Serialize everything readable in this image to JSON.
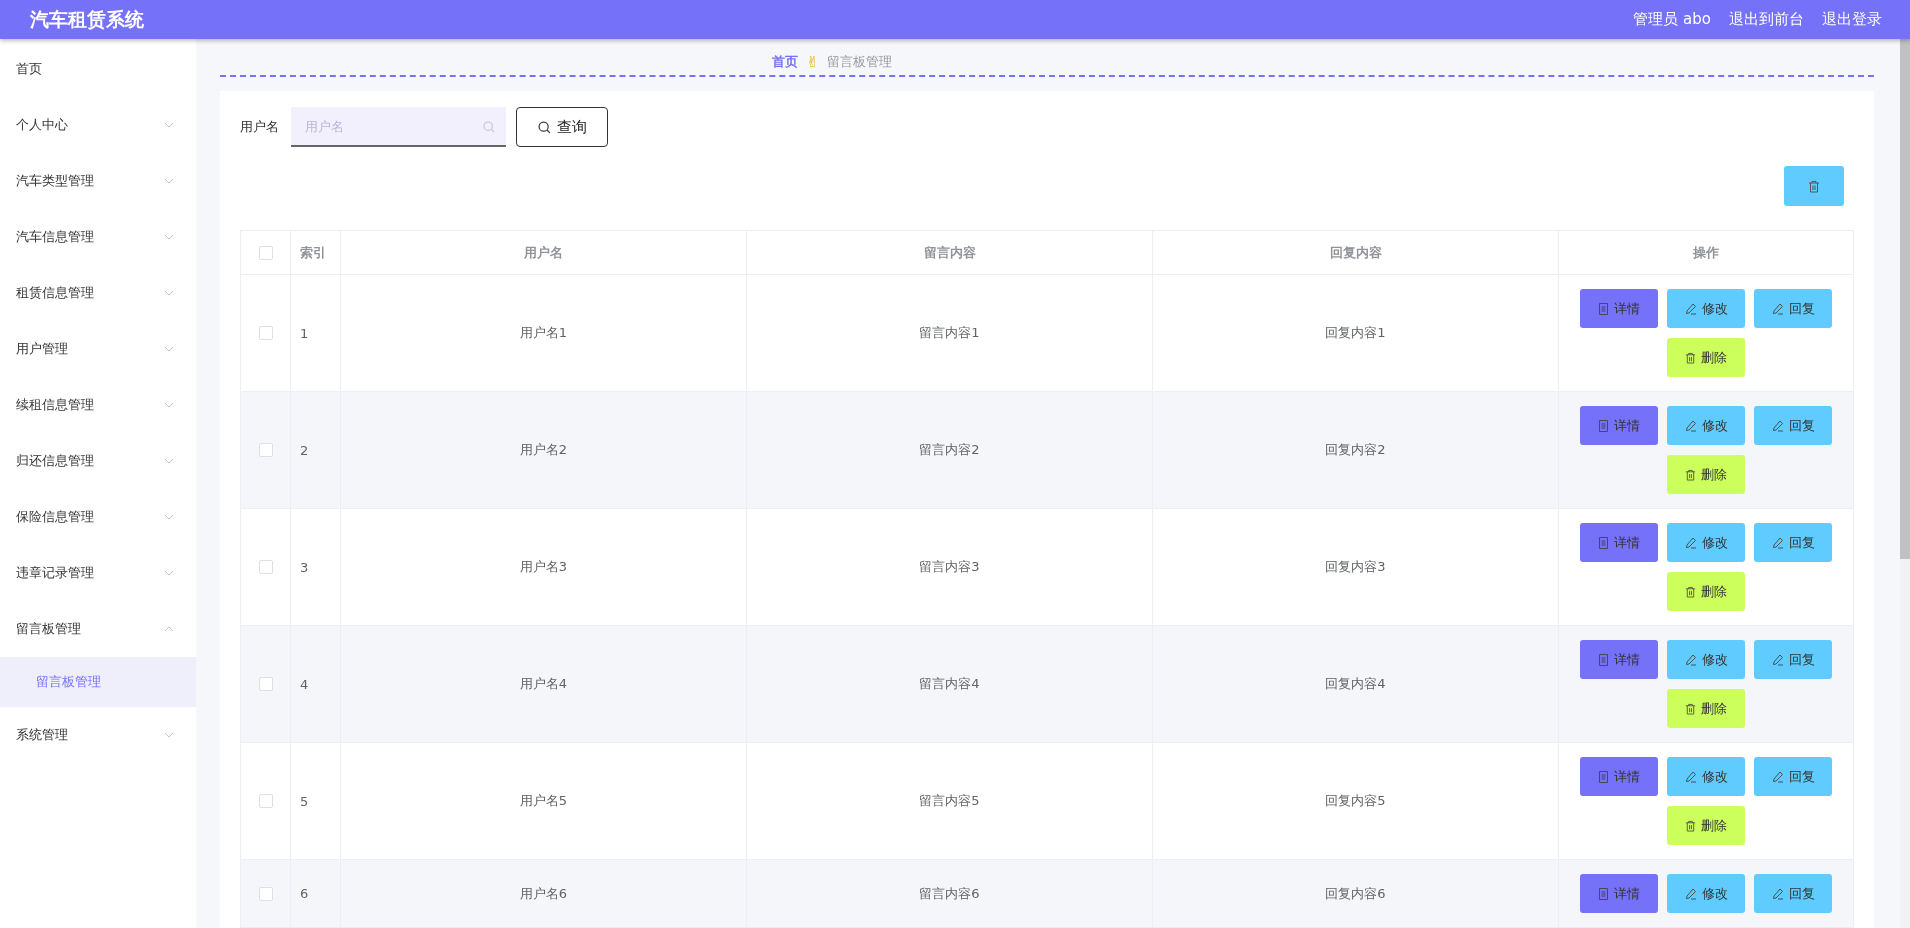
{
  "header": {
    "title": "汽车租赁系统",
    "links": [
      "管理员 abo",
      "退出到前台",
      "退出登录"
    ]
  },
  "sidebar": {
    "items": [
      {
        "label": "首页",
        "selected": false
      },
      {
        "label": "个人中心",
        "selected": false,
        "expanded": false
      },
      {
        "label": "汽车类型管理",
        "selected": false,
        "expanded": false
      },
      {
        "label": "汽车信息管理",
        "selected": false,
        "expanded": false
      },
      {
        "label": "租赁信息管理",
        "selected": false,
        "expanded": false
      },
      {
        "label": "用户管理",
        "selected": false,
        "expanded": false
      },
      {
        "label": "续租信息管理",
        "selected": false,
        "expanded": false
      },
      {
        "label": "归还信息管理",
        "selected": false,
        "expanded": false
      },
      {
        "label": "保险信息管理",
        "selected": false,
        "expanded": false
      },
      {
        "label": "违章记录管理",
        "selected": false,
        "expanded": false
      },
      {
        "label": "留言板管理",
        "selected": false,
        "expanded": true,
        "children": [
          {
            "label": "留言板管理",
            "selected": true
          }
        ]
      },
      {
        "label": "系统管理",
        "selected": false,
        "expanded": false
      }
    ]
  },
  "breadcrumb": {
    "home": "首页",
    "separator": "✌",
    "current": "留言板管理"
  },
  "search": {
    "label": "用户名",
    "placeholder": "用户名",
    "button": "查询"
  },
  "table": {
    "select_all_checked": false,
    "columns": [
      "索引",
      "用户名",
      "留言内容",
      "回复内容",
      "操作"
    ],
    "rows": [
      {
        "checked": false,
        "cells": [
          "1",
          "用户名1",
          "留言内容1",
          "回复内容1"
        ],
        "actions": [
          {
            "kind": "detail",
            "label": "详情"
          },
          {
            "kind": "edit",
            "label": "修改"
          },
          {
            "kind": "reply",
            "label": "回复"
          },
          {
            "kind": "delete",
            "label": "删除"
          }
        ]
      },
      {
        "checked": false,
        "cells": [
          "2",
          "用户名2",
          "留言内容2",
          "回复内容2"
        ],
        "actions": [
          {
            "kind": "detail",
            "label": "详情"
          },
          {
            "kind": "edit",
            "label": "修改"
          },
          {
            "kind": "reply",
            "label": "回复"
          },
          {
            "kind": "delete",
            "label": "删除"
          }
        ]
      },
      {
        "checked": false,
        "cells": [
          "3",
          "用户名3",
          "留言内容3",
          "回复内容3"
        ],
        "actions": [
          {
            "kind": "detail",
            "label": "详情"
          },
          {
            "kind": "edit",
            "label": "修改"
          },
          {
            "kind": "reply",
            "label": "回复"
          },
          {
            "kind": "delete",
            "label": "删除"
          }
        ]
      },
      {
        "checked": false,
        "cells": [
          "4",
          "用户名4",
          "留言内容4",
          "回复内容4"
        ],
        "actions": [
          {
            "kind": "detail",
            "label": "详情"
          },
          {
            "kind": "edit",
            "label": "修改"
          },
          {
            "kind": "reply",
            "label": "回复"
          },
          {
            "kind": "delete",
            "label": "删除"
          }
        ]
      },
      {
        "checked": false,
        "cells": [
          "5",
          "用户名5",
          "留言内容5",
          "回复内容5"
        ],
        "actions": [
          {
            "kind": "detail",
            "label": "详情"
          },
          {
            "kind": "edit",
            "label": "修改"
          },
          {
            "kind": "reply",
            "label": "回复"
          },
          {
            "kind": "delete",
            "label": "删除"
          }
        ]
      },
      {
        "checked": false,
        "cells": [
          "6",
          "用户名6",
          "留言内容6",
          "回复内容6"
        ],
        "actions": [
          {
            "kind": "detail",
            "label": "详情"
          },
          {
            "kind": "edit",
            "label": "修改"
          },
          {
            "kind": "reply",
            "label": "回复"
          }
        ]
      }
    ]
  }
}
